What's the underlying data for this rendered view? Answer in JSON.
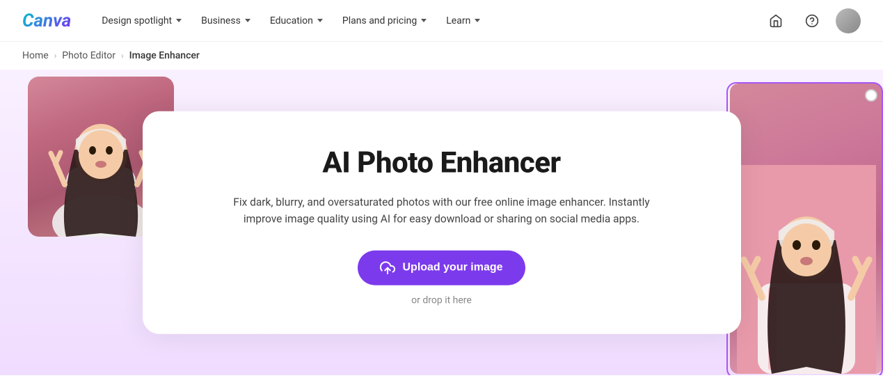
{
  "logo": {
    "text": "Canva"
  },
  "navbar": {
    "items": [
      {
        "id": "design-spotlight",
        "label": "Design spotlight",
        "hasDropdown": true
      },
      {
        "id": "business",
        "label": "Business",
        "hasDropdown": true
      },
      {
        "id": "education",
        "label": "Education",
        "hasDropdown": true
      },
      {
        "id": "plans-pricing",
        "label": "Plans and pricing",
        "hasDropdown": true
      },
      {
        "id": "learn",
        "label": "Learn",
        "hasDropdown": true
      }
    ],
    "icons": {
      "home": "⌂",
      "help": "?",
      "avatar_alt": "User avatar"
    }
  },
  "breadcrumb": {
    "items": [
      {
        "id": "home",
        "label": "Home"
      },
      {
        "id": "photo-editor",
        "label": "Photo Editor"
      },
      {
        "id": "image-enhancer",
        "label": "Image Enhancer"
      }
    ]
  },
  "hero": {
    "title": "AI Photo Enhancer",
    "description": "Fix dark, blurry, and oversaturated photos with our free online image enhancer. Instantly improve image quality using AI for easy download or sharing on social media apps.",
    "upload_button": "Upload your image",
    "drop_text": "or drop it here"
  }
}
